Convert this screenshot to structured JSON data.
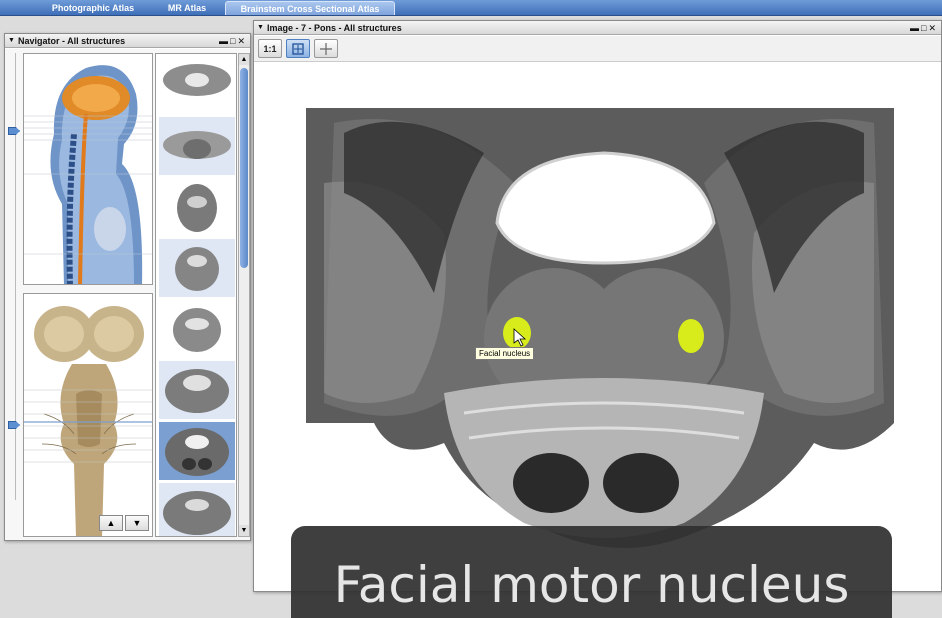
{
  "tabs": [
    {
      "label": "Photographic Atlas",
      "active": false
    },
    {
      "label": "MR Atlas",
      "active": false
    },
    {
      "label": "Brainstem Cross Sectional Atlas",
      "active": true
    }
  ],
  "navigator": {
    "title": "Navigator - All structures",
    "controls": {
      "minimize": "▬",
      "restore": "□",
      "close": "✕"
    },
    "up_label": "▲",
    "down_label": "▼",
    "scroll_up": "▲",
    "scroll_down": "▼"
  },
  "image_window": {
    "title": "Image - 7 - Pons - All structures",
    "controls": {
      "minimize": "▬",
      "restore": "□",
      "close": "✕"
    },
    "tools": [
      "1:1",
      "fit-icon",
      "crosshair-icon"
    ],
    "tool_1_label": "1:1",
    "tooltip": "Facial nucleus"
  },
  "caption": "Facial motor nucleus",
  "colors": {
    "tab_bar": "#4a7cc4",
    "highlight_structure": "#d8ec1c",
    "selected_thumb": "#7b9fd0",
    "caption_bg": "#303030"
  }
}
